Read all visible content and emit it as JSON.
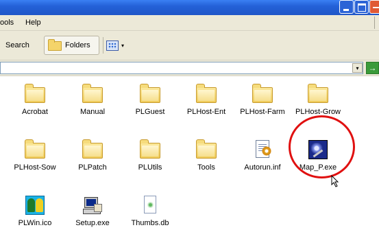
{
  "menu": {
    "tools_label": "ools",
    "help_label": "Help"
  },
  "toolbar": {
    "search_label": "Search",
    "folders_label": "Folders",
    "views_arrow": "▾"
  },
  "address": {
    "dropdown_glyph": "▾",
    "go_glyph": "→"
  },
  "items": [
    {
      "label": "Acrobat",
      "icon": "folder-icon"
    },
    {
      "label": "Manual",
      "icon": "folder-icon"
    },
    {
      "label": "PLGuest",
      "icon": "folder-icon"
    },
    {
      "label": "PLHost-Ent",
      "icon": "folder-icon"
    },
    {
      "label": "PLHost-Farm",
      "icon": "folder-icon"
    },
    {
      "label": "PLHost-Grow",
      "icon": "folder-icon"
    },
    {
      "label": "PLHost-Sow",
      "icon": "folder-icon"
    },
    {
      "label": "PLPatch",
      "icon": "folder-icon"
    },
    {
      "label": "PLUtils",
      "icon": "folder-icon"
    },
    {
      "label": "Tools",
      "icon": "folder-icon"
    },
    {
      "label": "Autorun.inf",
      "icon": "inf-file-icon"
    },
    {
      "label": "Map_P.exe",
      "icon": "map-app-icon"
    },
    {
      "label": "PLWin.ico",
      "icon": "ico-file-icon"
    },
    {
      "label": "Setup.exe",
      "icon": "setup-icon"
    },
    {
      "label": "Thumbs.db",
      "icon": "db-file-icon"
    }
  ],
  "colors": {
    "titlebar": "#2461d8",
    "chrome": "#ece9d8",
    "highlight": "#e01010",
    "folder": "#f0cc5a"
  }
}
